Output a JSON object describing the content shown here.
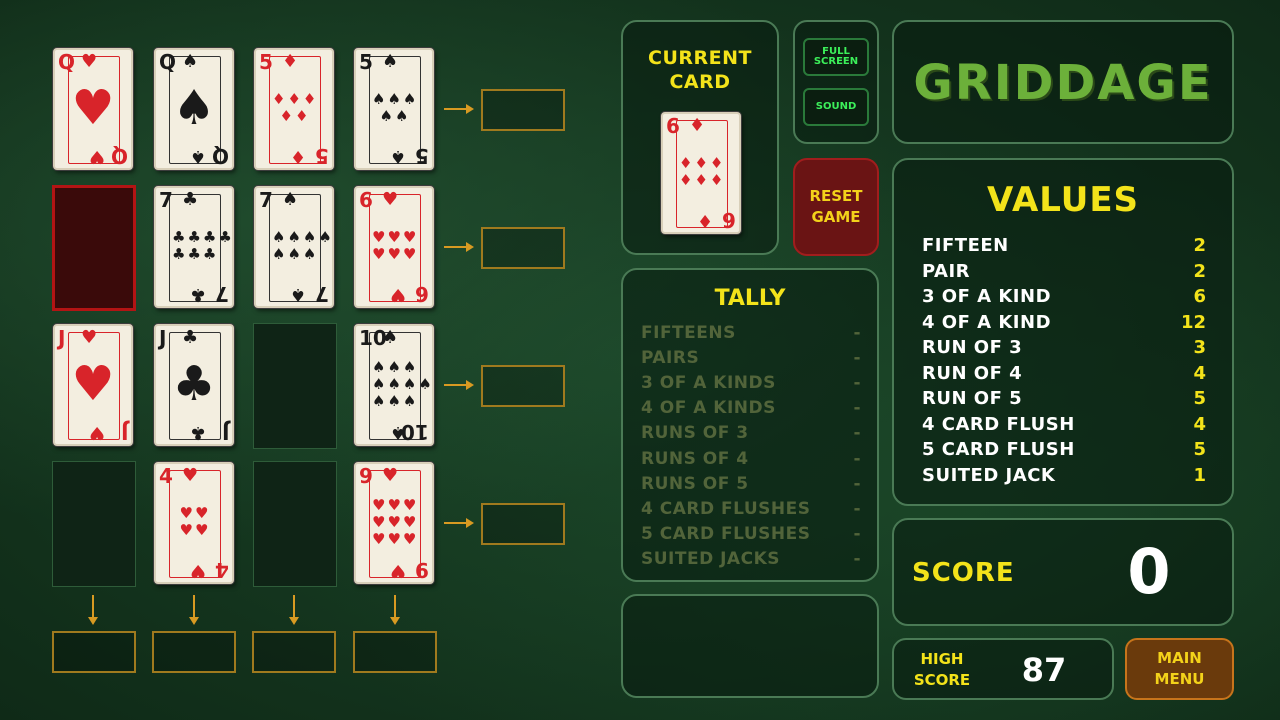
{
  "game_title": "GRIDDAGE",
  "grid": [
    [
      {
        "rank": "Q",
        "suit": "♥",
        "color": "red",
        "face": true
      },
      {
        "rank": "Q",
        "suit": "♠",
        "color": "black",
        "face": true
      },
      {
        "rank": "5",
        "suit": "♦",
        "color": "red"
      },
      {
        "rank": "5",
        "suit": "♠",
        "color": "black"
      }
    ],
    [
      null,
      {
        "rank": "7",
        "suit": "♣",
        "color": "black"
      },
      {
        "rank": "7",
        "suit": "♠",
        "color": "black"
      },
      {
        "rank": "6",
        "suit": "♥",
        "color": "red"
      }
    ],
    [
      {
        "rank": "J",
        "suit": "♥",
        "color": "red",
        "face": true
      },
      {
        "rank": "J",
        "suit": "♣",
        "color": "black",
        "face": true
      },
      null,
      {
        "rank": "10",
        "suit": "♠",
        "color": "black"
      }
    ],
    [
      null,
      {
        "rank": "4",
        "suit": "♥",
        "color": "red"
      },
      null,
      {
        "rank": "9",
        "suit": "♥",
        "color": "red"
      }
    ]
  ],
  "current_card_panel": {
    "label": "CURRENT CARD",
    "card": {
      "rank": "6",
      "suit": "♦",
      "color": "red"
    }
  },
  "buttons": {
    "full_screen": "FULL SCREEN",
    "sound": "SOUND",
    "reset_game": "RESET GAME",
    "main_menu": "MAIN MENU"
  },
  "tally": {
    "title": "TALLY",
    "rows": [
      {
        "label": "FIFTEENS",
        "value": "-"
      },
      {
        "label": "PAIRS",
        "value": "-"
      },
      {
        "label": "3 OF A KINDS",
        "value": "-"
      },
      {
        "label": "4 OF A KINDS",
        "value": "-"
      },
      {
        "label": "RUNS OF 3",
        "value": "-"
      },
      {
        "label": "RUNS OF 4",
        "value": "-"
      },
      {
        "label": "RUNS OF 5",
        "value": "-"
      },
      {
        "label": "4 CARD FLUSHES",
        "value": "-"
      },
      {
        "label": "5 CARD FLUSHES",
        "value": "-"
      },
      {
        "label": "SUITED JACKS",
        "value": "-"
      }
    ]
  },
  "values": {
    "title": "VALUES",
    "rows": [
      {
        "label": "FIFTEEN",
        "value": "2"
      },
      {
        "label": "PAIR",
        "value": "2"
      },
      {
        "label": "3 OF A KIND",
        "value": "6"
      },
      {
        "label": "4 OF A KIND",
        "value": "12"
      },
      {
        "label": "RUN OF 3",
        "value": "3"
      },
      {
        "label": "RUN OF 4",
        "value": "4"
      },
      {
        "label": "RUN OF 5",
        "value": "5"
      },
      {
        "label": "4 CARD FLUSH",
        "value": "4"
      },
      {
        "label": "5 CARD FLUSH",
        "value": "5"
      },
      {
        "label": "SUITED JACK",
        "value": "1"
      }
    ]
  },
  "score": {
    "label": "SCORE",
    "value": "0"
  },
  "high_score": {
    "label": "HIGH SCORE",
    "value": "87"
  },
  "colors": {
    "accent_yellow": "#f3e31a",
    "title_green": "#6cb03a",
    "button_green_text": "#3cf05a",
    "selected_slot": "#b31414"
  }
}
